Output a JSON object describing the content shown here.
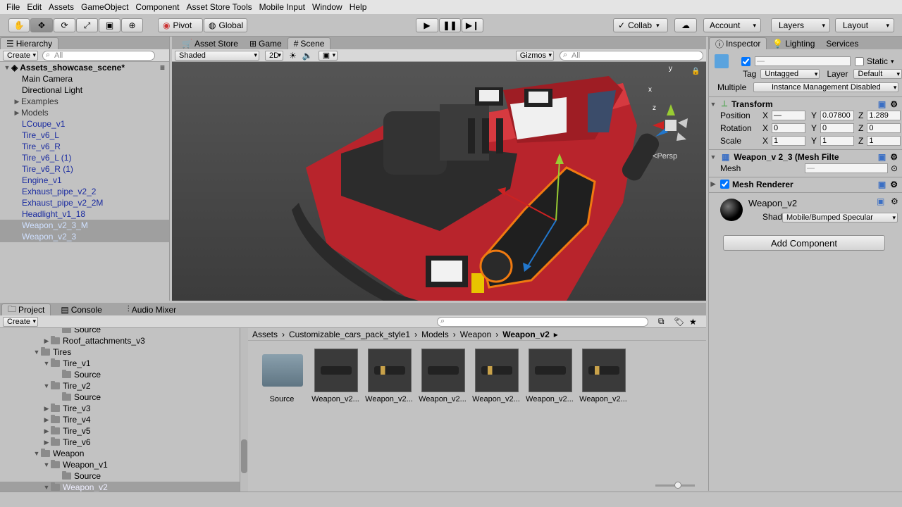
{
  "menu": [
    "File",
    "Edit",
    "Assets",
    "GameObject",
    "Component",
    "Asset Store Tools",
    "Mobile Input",
    "Window",
    "Help"
  ],
  "toolbar": {
    "pivot": "Pivot",
    "global": "Global",
    "collab": "Collab",
    "account": "Account",
    "layers": "Layers",
    "layout": "Layout"
  },
  "hierarchy": {
    "tab": "Hierarchy",
    "create": "Create",
    "search_placeholder": "All",
    "scene": "Assets_showcase_scene*",
    "items": [
      {
        "label": "Main Camera"
      },
      {
        "label": "Directional Light"
      },
      {
        "label": "Examples"
      },
      {
        "label": "Models"
      },
      {
        "label": "LCoupe_v1"
      },
      {
        "label": "Tire_v6_L"
      },
      {
        "label": "Tire_v6_R"
      },
      {
        "label": "Tire_v6_L (1)"
      },
      {
        "label": "Tire_v6_R (1)"
      },
      {
        "label": "Engine_v1"
      },
      {
        "label": "Exhaust_pipe_v2_2"
      },
      {
        "label": "Exhaust_pipe_v2_2M"
      },
      {
        "label": "Headlight_v1_18"
      },
      {
        "label": "Weapon_v2_3_M"
      },
      {
        "label": "Weapon_v2_3"
      }
    ]
  },
  "scene": {
    "tabs": [
      "Asset Store",
      "Game",
      "Scene"
    ],
    "shading": "Shaded",
    "mode2d": "2D",
    "gizmos": "Gizmos",
    "search_placeholder": "All",
    "persp": "Persp",
    "gizmo_y": "y",
    "gizmo_x": "x",
    "gizmo_z": "z"
  },
  "project": {
    "tabs": [
      "Project",
      "Console",
      "Audio Mixer"
    ],
    "create": "Create",
    "tree": [
      {
        "label": "Source"
      },
      {
        "label": "Roof_attachments_v3"
      },
      {
        "label": "Tires"
      },
      {
        "label": "Tire_v1"
      },
      {
        "label": "Source"
      },
      {
        "label": "Tire_v2"
      },
      {
        "label": "Source"
      },
      {
        "label": "Tire_v3"
      },
      {
        "label": "Tire_v4"
      },
      {
        "label": "Tire_v5"
      },
      {
        "label": "Tire_v6"
      },
      {
        "label": "Weapon"
      },
      {
        "label": "Weapon_v1"
      },
      {
        "label": "Source"
      },
      {
        "label": "Weapon_v2"
      }
    ],
    "breadcrumb": [
      "Assets",
      "Customizable_cars_pack_style1",
      "Models",
      "Weapon",
      "Weapon_v2"
    ],
    "assets": [
      {
        "label": "Source"
      },
      {
        "label": "Weapon_v2..."
      },
      {
        "label": "Weapon_v2..."
      },
      {
        "label": "Weapon_v2..."
      },
      {
        "label": "Weapon_v2..."
      },
      {
        "label": "Weapon_v2..."
      },
      {
        "label": "Weapon_v2..."
      }
    ]
  },
  "inspector": {
    "tabs": [
      "Inspector",
      "Lighting",
      "Services"
    ],
    "name": "—",
    "static": "Static",
    "tag_label": "Tag",
    "tag": "Untagged",
    "layer_label": "Layer",
    "layer": "Default",
    "multiple_label": "Multiple",
    "multiple_note": "Instance Management Disabled",
    "transform": {
      "title": "Transform",
      "position": {
        "label": "Position",
        "x": "—",
        "y": "0.07800",
        "z": "1.289"
      },
      "rotation": {
        "label": "Rotation",
        "x": "0",
        "y": "0",
        "z": "0"
      },
      "scale": {
        "label": "Scale",
        "x": "1",
        "y": "1",
        "z": "1"
      }
    },
    "mesh_filter": {
      "title": "Weapon_v 2_3 (Mesh Filte",
      "mesh_label": "Mesh",
      "mesh": "—"
    },
    "mesh_renderer": {
      "title": "Mesh Renderer"
    },
    "material": {
      "name": "Weapon_v2",
      "shader_label": "Shader",
      "shader": "Mobile/Bumped Specular"
    },
    "add_component": "Add Component",
    "axis": {
      "x": "X",
      "y": "Y",
      "z": "Z"
    }
  }
}
